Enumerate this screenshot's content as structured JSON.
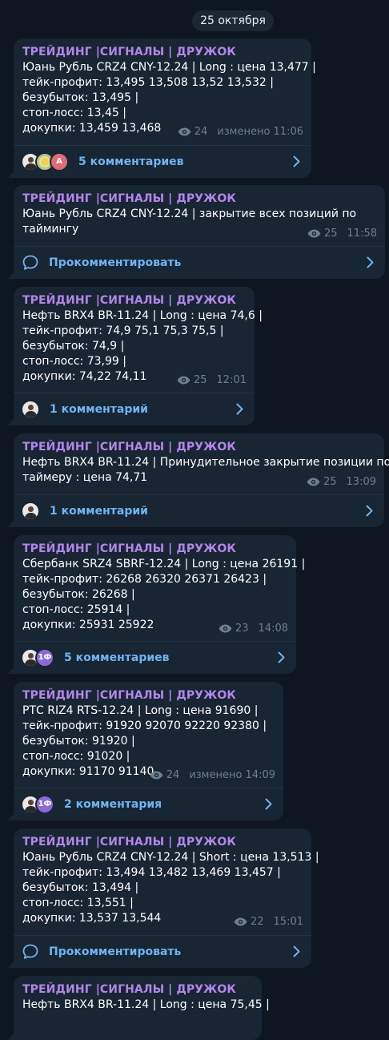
{
  "date_chip": "25 октября",
  "channel_name": "ТРЕЙДИНГ |СИГНАЛЫ | ДРУЖОК",
  "colors": {
    "background": "#0e1621",
    "bubble": "#182533",
    "channel_name": "#b286e8",
    "link": "#6fb4f0",
    "meta": "#6d7f8f"
  },
  "messages": [
    {
      "lines": [
        "Юань Рубль  CRZ4 CNY-12.24 | Long : цена 13,477 |",
        "тейк-профит: 13,495 13,508 13,52 13,532 |",
        "безубыток: 13,495 |",
        "стоп-лосс: 13,45 |",
        "докупки: 13,459 13,468"
      ],
      "views": "24",
      "time": "изменено 11:06",
      "comments": "5 комментариев",
      "avatars": [
        "person",
        "flower",
        "letter-A"
      ],
      "avatar_letter": "A"
    },
    {
      "lines": [
        "Юань Рубль CRZ4 CNY-12.24 | закрытие всех позиций по",
        "таймингу"
      ],
      "views": "25",
      "time": "11:58",
      "comments": "Прокомментировать",
      "avatars": []
    },
    {
      "lines": [
        "Нефть BRX4 BR-11.24 | Long : цена 74,6 |",
        "тейк-профит: 74,9 75,1 75,3 75,5 |",
        "безубыток: 74,9 |",
        "стоп-лосс: 73,99 |",
        "докупки: 74,22 74,11"
      ],
      "views": "25",
      "time": "12:01",
      "comments": "1 комментарий",
      "avatars": [
        "person"
      ]
    },
    {
      "lines": [
        "Нефть BRX4 BR-11.24 | Принудительное закрытие позиции по",
        "таймеру : цена 74,71"
      ],
      "views": "25",
      "time": "13:09",
      "comments": "1 комментарий",
      "avatars": [
        "person"
      ]
    },
    {
      "lines": [
        "Сбербанк SRZ4 SBRF-12.24 | Long : цена 26191 |",
        "тейк-профит: 26268 26320 26371 26423 |",
        "безубыток: 26268 |",
        "стоп-лосс: 25914 |",
        "докупки: 25931 25922"
      ],
      "views": "23",
      "time": "14:08",
      "comments": "5 комментариев",
      "avatars": [
        "person",
        "letter-1Ф"
      ],
      "avatar_letter": "1Ф"
    },
    {
      "lines": [
        "РТС RIZ4 RTS-12.24 | Long : цена 91690 |",
        "тейк-профит: 91920 92070 92220 92380 |",
        "безубыток: 91920 |",
        "стоп-лосс: 91020 |",
        "докупки: 91170 91140"
      ],
      "views": "24",
      "time": "изменено 14:09",
      "comments": "2 комментария",
      "avatars": [
        "person",
        "letter-1Ф"
      ],
      "avatar_letter": "1Ф"
    },
    {
      "lines": [
        "Юань Рубль CRZ4 CNY-12.24 | Short : цена 13,513 |",
        "тейк-профит: 13,494 13,482 13,469 13,457 |",
        "безубыток: 13,494 |",
        "стоп-лосс: 13,551 |",
        "докупки: 13,537 13,544"
      ],
      "views": "22",
      "time": "15:01",
      "comments": "Прокомментировать",
      "avatars": []
    },
    {
      "lines": [
        "Нефть BRX4 BR-11.24 | Long : цена 75,45 |"
      ],
      "views": "",
      "time": "",
      "comments": "",
      "avatars": []
    }
  ]
}
